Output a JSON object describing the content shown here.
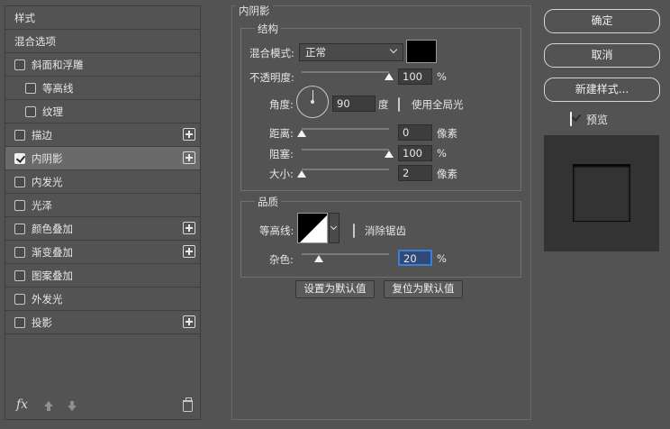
{
  "left_panel": {
    "items": [
      {
        "label": "样式",
        "checkbox": null,
        "checked": false,
        "plus": false,
        "indent": 0,
        "selected": false
      },
      {
        "label": "混合选项",
        "checkbox": null,
        "checked": false,
        "plus": false,
        "indent": 0,
        "selected": false
      },
      {
        "label": "斜面和浮雕",
        "checkbox": true,
        "checked": false,
        "plus": false,
        "indent": 0,
        "selected": false
      },
      {
        "label": "等高线",
        "checkbox": true,
        "checked": false,
        "plus": false,
        "indent": 1,
        "selected": false
      },
      {
        "label": "纹理",
        "checkbox": true,
        "checked": false,
        "plus": false,
        "indent": 1,
        "selected": false
      },
      {
        "label": "描边",
        "checkbox": true,
        "checked": false,
        "plus": true,
        "indent": 0,
        "selected": false
      },
      {
        "label": "内阴影",
        "checkbox": true,
        "checked": true,
        "plus": true,
        "indent": 0,
        "selected": true
      },
      {
        "label": "内发光",
        "checkbox": true,
        "checked": false,
        "plus": false,
        "indent": 0,
        "selected": false
      },
      {
        "label": "光泽",
        "checkbox": true,
        "checked": false,
        "plus": false,
        "indent": 0,
        "selected": false
      },
      {
        "label": "颜色叠加",
        "checkbox": true,
        "checked": false,
        "plus": true,
        "indent": 0,
        "selected": false
      },
      {
        "label": "渐变叠加",
        "checkbox": true,
        "checked": false,
        "plus": true,
        "indent": 0,
        "selected": false
      },
      {
        "label": "图案叠加",
        "checkbox": true,
        "checked": false,
        "plus": false,
        "indent": 0,
        "selected": false
      },
      {
        "label": "外发光",
        "checkbox": true,
        "checked": false,
        "plus": false,
        "indent": 0,
        "selected": false
      },
      {
        "label": "投影",
        "checkbox": true,
        "checked": false,
        "plus": true,
        "indent": 0,
        "selected": false
      }
    ],
    "footer": {
      "fx_label": "fx"
    }
  },
  "inner_shadow": {
    "title": "内阴影",
    "structure": {
      "title": "结构",
      "blend_mode_label": "混合模式:",
      "blend_mode_value": "正常",
      "shadow_color": "#000000",
      "opacity_label": "不透明度:",
      "opacity_value": "100",
      "opacity_fraction": 1.0,
      "angle_label": "角度:",
      "angle_value": "90",
      "angle_unit": "度",
      "global_light_label": "使用全局光",
      "global_light_checked": false,
      "distance_label": "距离:",
      "distance_value": "0",
      "distance_unit": "像素",
      "distance_fraction": 0.0,
      "choke_label": "阻塞:",
      "choke_value": "100",
      "choke_fraction": 1.0,
      "size_label": "大小:",
      "size_value": "2",
      "size_unit": "像素",
      "size_fraction": 0.0,
      "percent_unit": "%"
    },
    "quality": {
      "title": "品质",
      "contour_label": "等高线:",
      "anti_alias_label": "消除锯齿",
      "anti_alias_checked": false,
      "noise_label": "杂色:",
      "noise_value": "20",
      "noise_fraction": 0.2,
      "percent_unit": "%"
    },
    "make_default_label": "设置为默认值",
    "reset_default_label": "复位为默认值"
  },
  "right_panel": {
    "ok_label": "确定",
    "cancel_label": "取消",
    "new_style_label": "新建样式...",
    "preview_label": "预览",
    "preview_checked": true
  }
}
